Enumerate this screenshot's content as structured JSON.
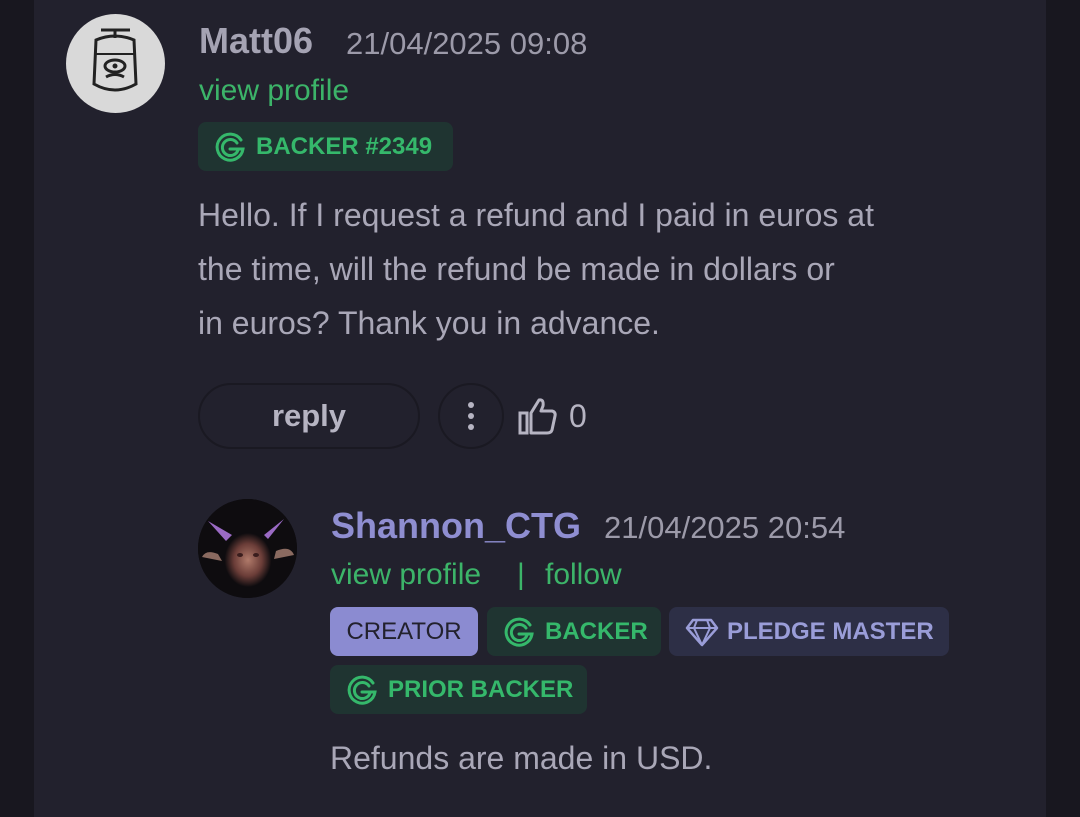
{
  "comment": {
    "username": "Matt06",
    "timestamp": "21/04/2025 09:08",
    "view_profile": "view profile",
    "badge": "BACKER #2349",
    "text_lines": [
      "Hello. If I request a refund and I paid in euros at",
      "the time, will the refund be made in dollars or",
      "in euros? Thank you in advance."
    ],
    "reply_label": "reply",
    "like_count": "0"
  },
  "reply": {
    "username": "Shannon_CTG",
    "timestamp": "21/04/2025 20:54",
    "view_profile": "view profile",
    "separator": "|",
    "follow": "follow",
    "badges": {
      "creator": "CREATOR",
      "backer": "BACKER",
      "pledge_master": "PLEDGE MASTER",
      "prior_backer": "PRIOR BACKER"
    },
    "text": "Refunds are made in USD."
  },
  "colors": {
    "background": "#18171f",
    "panel": "#22212d",
    "link_green": "#3cb469",
    "creator_purple": "#8b8bd1"
  },
  "icons": [
    "backer-g-icon",
    "diamond-icon",
    "more-vertical-icon",
    "thumbs-up-icon"
  ]
}
